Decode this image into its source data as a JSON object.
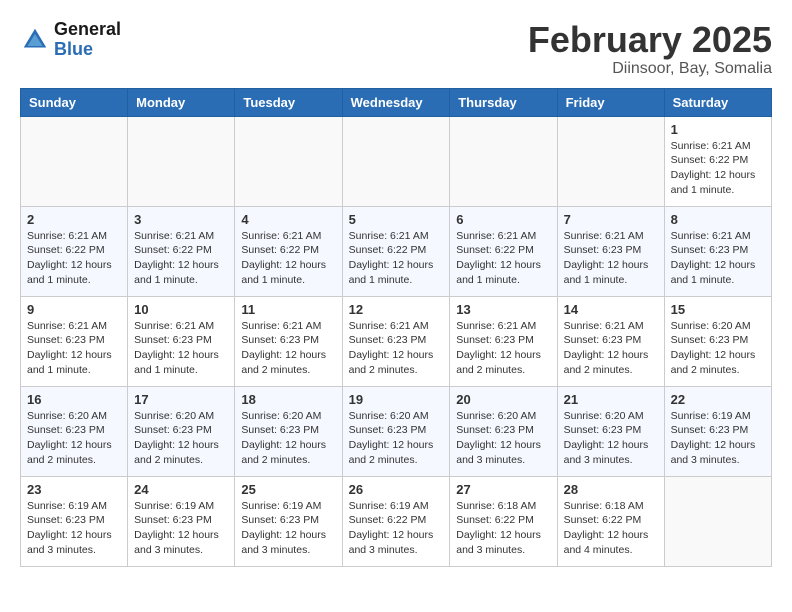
{
  "header": {
    "logo": {
      "general": "General",
      "blue": "Blue"
    },
    "title": "February 2025",
    "location": "Diinsoor, Bay, Somalia"
  },
  "days_of_week": [
    "Sunday",
    "Monday",
    "Tuesday",
    "Wednesday",
    "Thursday",
    "Friday",
    "Saturday"
  ],
  "weeks": [
    {
      "days": [
        {
          "number": "",
          "info": ""
        },
        {
          "number": "",
          "info": ""
        },
        {
          "number": "",
          "info": ""
        },
        {
          "number": "",
          "info": ""
        },
        {
          "number": "",
          "info": ""
        },
        {
          "number": "",
          "info": ""
        },
        {
          "number": "1",
          "info": "Sunrise: 6:21 AM\nSunset: 6:22 PM\nDaylight: 12 hours and 1 minute."
        }
      ]
    },
    {
      "days": [
        {
          "number": "2",
          "info": "Sunrise: 6:21 AM\nSunset: 6:22 PM\nDaylight: 12 hours and 1 minute."
        },
        {
          "number": "3",
          "info": "Sunrise: 6:21 AM\nSunset: 6:22 PM\nDaylight: 12 hours and 1 minute."
        },
        {
          "number": "4",
          "info": "Sunrise: 6:21 AM\nSunset: 6:22 PM\nDaylight: 12 hours and 1 minute."
        },
        {
          "number": "5",
          "info": "Sunrise: 6:21 AM\nSunset: 6:22 PM\nDaylight: 12 hours and 1 minute."
        },
        {
          "number": "6",
          "info": "Sunrise: 6:21 AM\nSunset: 6:22 PM\nDaylight: 12 hours and 1 minute."
        },
        {
          "number": "7",
          "info": "Sunrise: 6:21 AM\nSunset: 6:23 PM\nDaylight: 12 hours and 1 minute."
        },
        {
          "number": "8",
          "info": "Sunrise: 6:21 AM\nSunset: 6:23 PM\nDaylight: 12 hours and 1 minute."
        }
      ]
    },
    {
      "days": [
        {
          "number": "9",
          "info": "Sunrise: 6:21 AM\nSunset: 6:23 PM\nDaylight: 12 hours and 1 minute."
        },
        {
          "number": "10",
          "info": "Sunrise: 6:21 AM\nSunset: 6:23 PM\nDaylight: 12 hours and 1 minute."
        },
        {
          "number": "11",
          "info": "Sunrise: 6:21 AM\nSunset: 6:23 PM\nDaylight: 12 hours and 2 minutes."
        },
        {
          "number": "12",
          "info": "Sunrise: 6:21 AM\nSunset: 6:23 PM\nDaylight: 12 hours and 2 minutes."
        },
        {
          "number": "13",
          "info": "Sunrise: 6:21 AM\nSunset: 6:23 PM\nDaylight: 12 hours and 2 minutes."
        },
        {
          "number": "14",
          "info": "Sunrise: 6:21 AM\nSunset: 6:23 PM\nDaylight: 12 hours and 2 minutes."
        },
        {
          "number": "15",
          "info": "Sunrise: 6:20 AM\nSunset: 6:23 PM\nDaylight: 12 hours and 2 minutes."
        }
      ]
    },
    {
      "days": [
        {
          "number": "16",
          "info": "Sunrise: 6:20 AM\nSunset: 6:23 PM\nDaylight: 12 hours and 2 minutes."
        },
        {
          "number": "17",
          "info": "Sunrise: 6:20 AM\nSunset: 6:23 PM\nDaylight: 12 hours and 2 minutes."
        },
        {
          "number": "18",
          "info": "Sunrise: 6:20 AM\nSunset: 6:23 PM\nDaylight: 12 hours and 2 minutes."
        },
        {
          "number": "19",
          "info": "Sunrise: 6:20 AM\nSunset: 6:23 PM\nDaylight: 12 hours and 2 minutes."
        },
        {
          "number": "20",
          "info": "Sunrise: 6:20 AM\nSunset: 6:23 PM\nDaylight: 12 hours and 3 minutes."
        },
        {
          "number": "21",
          "info": "Sunrise: 6:20 AM\nSunset: 6:23 PM\nDaylight: 12 hours and 3 minutes."
        },
        {
          "number": "22",
          "info": "Sunrise: 6:19 AM\nSunset: 6:23 PM\nDaylight: 12 hours and 3 minutes."
        }
      ]
    },
    {
      "days": [
        {
          "number": "23",
          "info": "Sunrise: 6:19 AM\nSunset: 6:23 PM\nDaylight: 12 hours and 3 minutes."
        },
        {
          "number": "24",
          "info": "Sunrise: 6:19 AM\nSunset: 6:23 PM\nDaylight: 12 hours and 3 minutes."
        },
        {
          "number": "25",
          "info": "Sunrise: 6:19 AM\nSunset: 6:23 PM\nDaylight: 12 hours and 3 minutes."
        },
        {
          "number": "26",
          "info": "Sunrise: 6:19 AM\nSunset: 6:22 PM\nDaylight: 12 hours and 3 minutes."
        },
        {
          "number": "27",
          "info": "Sunrise: 6:18 AM\nSunset: 6:22 PM\nDaylight: 12 hours and 3 minutes."
        },
        {
          "number": "28",
          "info": "Sunrise: 6:18 AM\nSunset: 6:22 PM\nDaylight: 12 hours and 4 minutes."
        },
        {
          "number": "",
          "info": ""
        }
      ]
    }
  ]
}
